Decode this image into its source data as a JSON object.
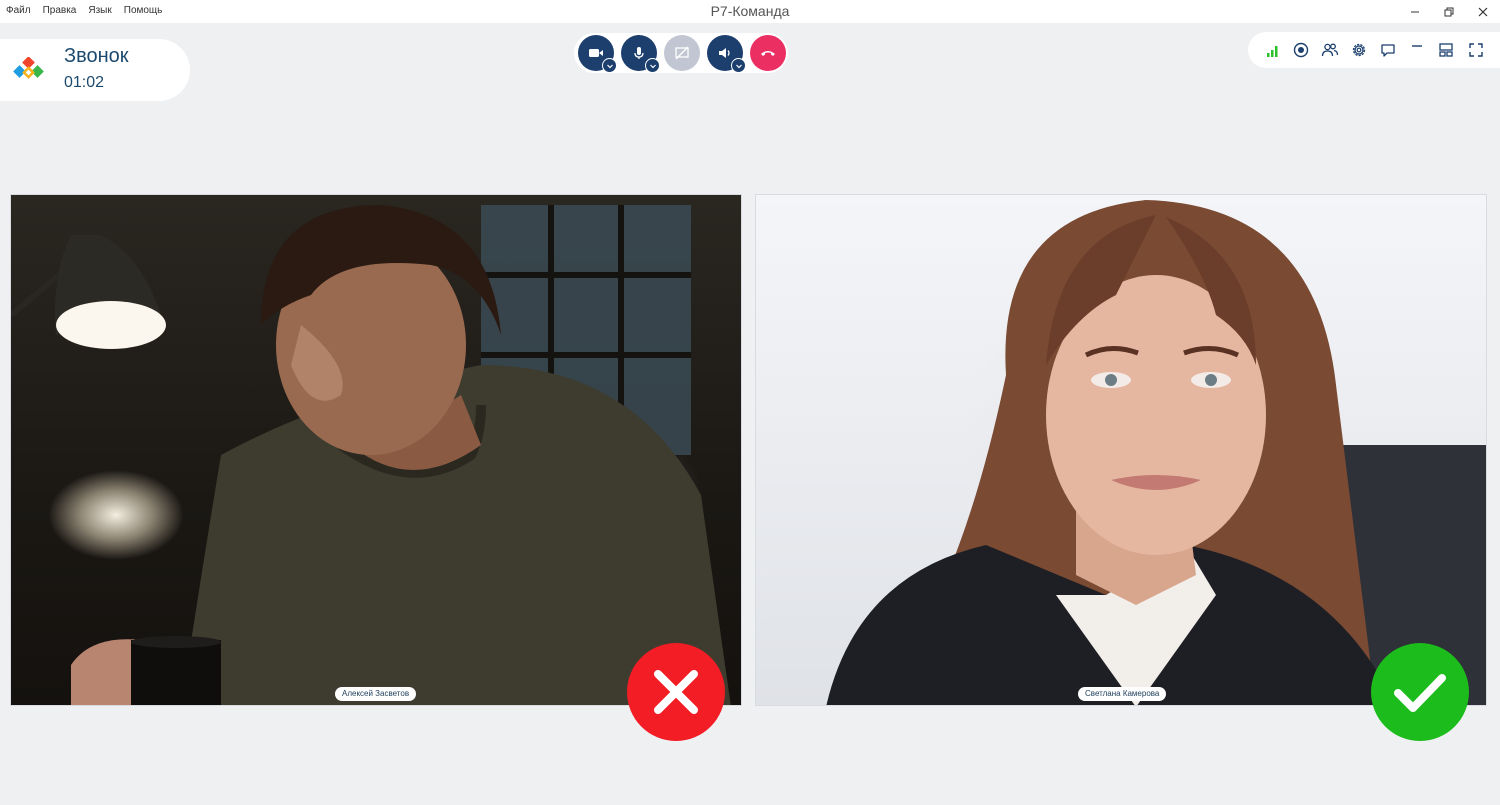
{
  "menu": [
    "Файл",
    "Правка",
    "Язык",
    "Помощь"
  ],
  "window": {
    "title": "Р7-Команда"
  },
  "call": {
    "title": "Звонок",
    "timer": "01:02"
  },
  "participants": [
    {
      "name": "Алексей Засветов",
      "status": "rejected"
    },
    {
      "name": "Светлана Камерова",
      "status": "accepted"
    }
  ],
  "colors": {
    "primary": "#1c3f6e",
    "hangup": "#ec2f63",
    "disabled": "#c1c6d2",
    "signal": "#2bc12b",
    "reject": "#f31d25",
    "accept": "#1cbc1c"
  },
  "controls": [
    "camera-icon",
    "microphone-icon",
    "screen-share-off-icon",
    "speaker-icon",
    "hang-up-icon"
  ],
  "toolbar_icons": [
    "signal-strength-icon",
    "record-icon",
    "participants-icon",
    "settings-icon",
    "chat-icon",
    "minimize-icon",
    "layout-icon",
    "fullscreen-icon"
  ]
}
